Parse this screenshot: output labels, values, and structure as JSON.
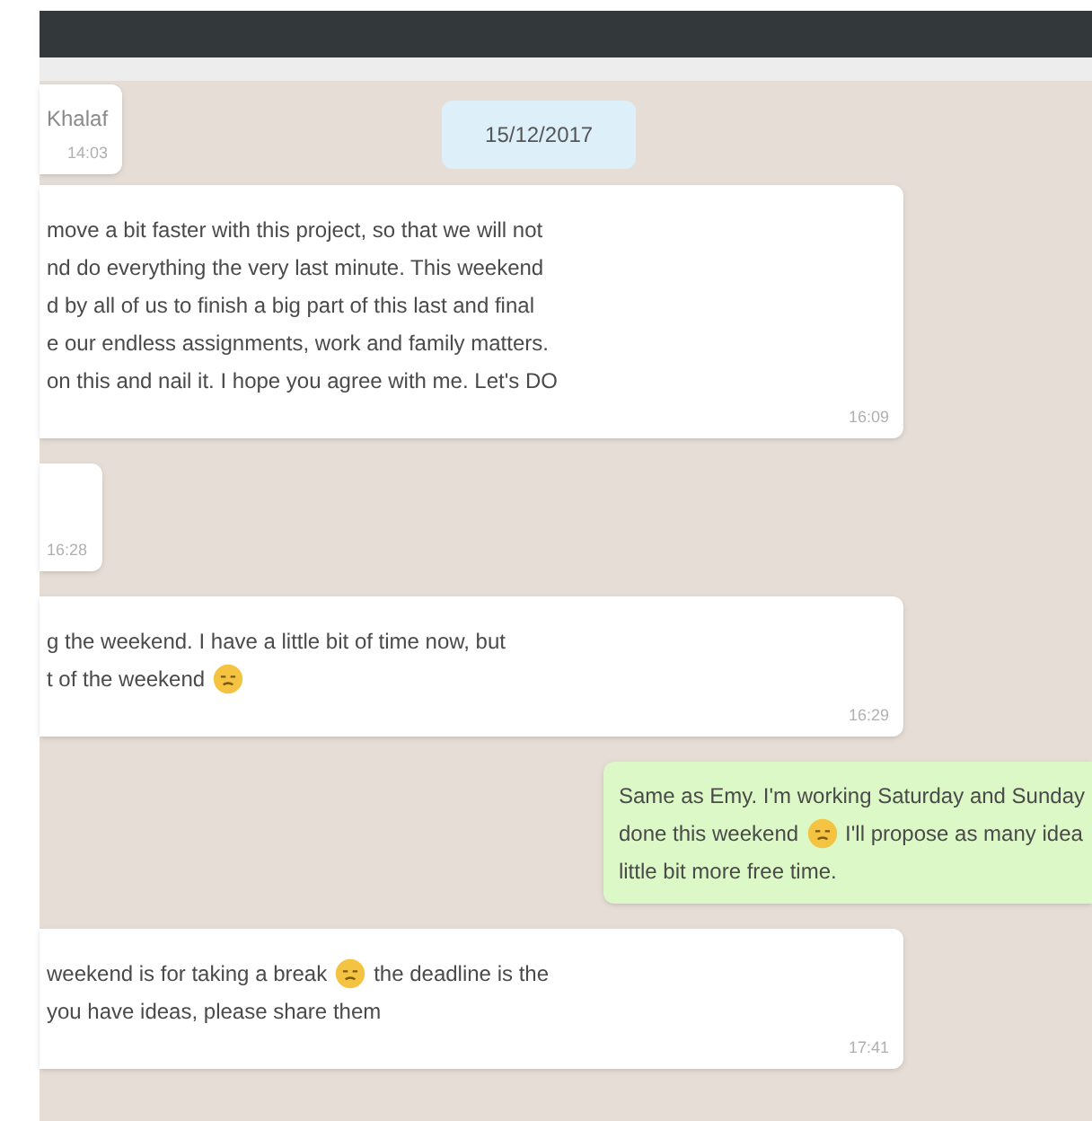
{
  "date_chip": "15/12/2017",
  "messages": [
    {
      "kind": "incoming",
      "sender": "Khalaf",
      "time": "14:03"
    },
    {
      "kind": "incoming",
      "lines": [
        [
          {
            "kind": "text",
            "text": "move a bit faster with this project, so that we will not"
          }
        ],
        [
          {
            "kind": "text",
            "text": "nd do everything the very last minute. This weekend"
          }
        ],
        [
          {
            "kind": "text",
            "text": "d by all of us to finish a big part of this last and final"
          }
        ],
        [
          {
            "kind": "text",
            "text": "e our endless assignments, work and family matters."
          }
        ],
        [
          {
            "kind": "text",
            "text": "on this and nail it. I hope you agree with me. Let's DO"
          }
        ]
      ],
      "time": "16:09"
    },
    {
      "kind": "incoming",
      "time": "16:28"
    },
    {
      "kind": "incoming",
      "lines": [
        [
          {
            "kind": "text",
            "text": "g the weekend. I have a little bit of time now, but"
          }
        ],
        [
          {
            "kind": "text",
            "text": "t of the weekend"
          },
          {
            "kind": "emoji"
          }
        ]
      ],
      "time": "16:29"
    },
    {
      "kind": "outgoing",
      "lines": [
        [
          {
            "kind": "text",
            "text": "Same as Emy. I'm working Saturday and Sunday"
          }
        ],
        [
          {
            "kind": "text",
            "text": "done this weekend"
          },
          {
            "kind": "emoji"
          },
          {
            "kind": "text",
            "text": "I'll propose as many idea"
          }
        ],
        [
          {
            "kind": "text",
            "text": "little bit more free time."
          }
        ]
      ]
    },
    {
      "kind": "incoming",
      "lines": [
        [
          {
            "kind": "text",
            "text": "weekend is for taking a break"
          },
          {
            "kind": "emoji"
          },
          {
            "kind": "text",
            "text": "the deadline is the"
          }
        ],
        [
          {
            "kind": "text",
            "text": "you have ideas, please share them"
          }
        ]
      ],
      "time": "17:41"
    }
  ]
}
